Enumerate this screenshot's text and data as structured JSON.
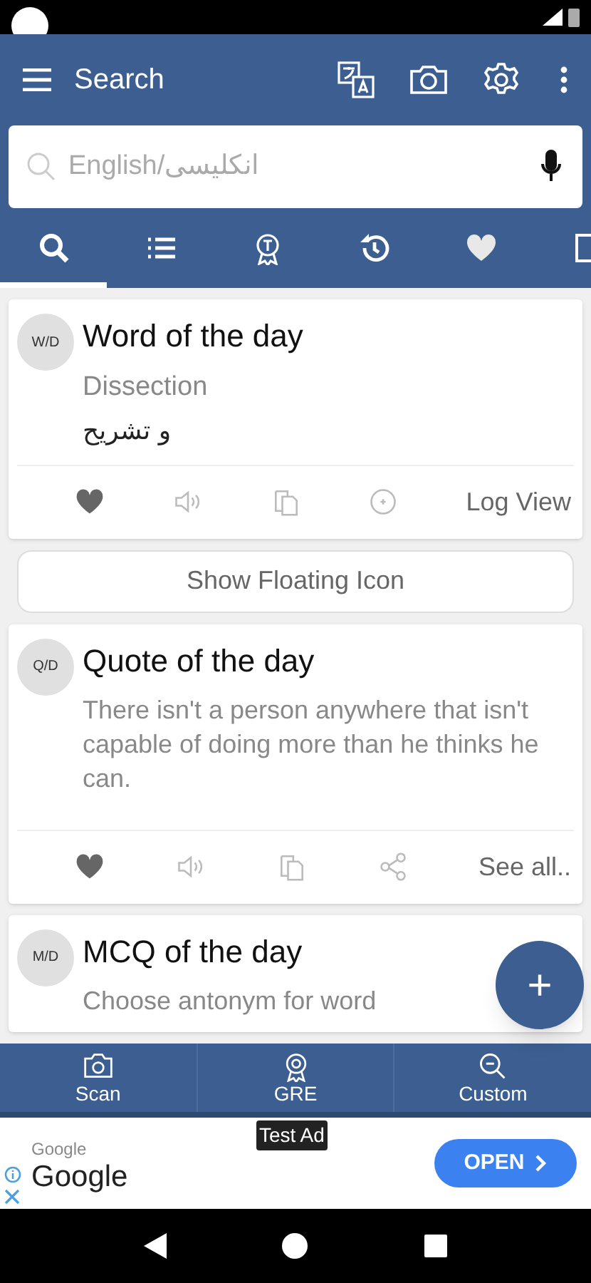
{
  "app_bar": {
    "title": "Search"
  },
  "search": {
    "placeholder": "English/انکلیسی"
  },
  "tabs": [
    {
      "kind": "search",
      "selected": true
    },
    {
      "kind": "list",
      "selected": false
    },
    {
      "kind": "award",
      "selected": false
    },
    {
      "kind": "history",
      "selected": false
    },
    {
      "kind": "heart",
      "selected": false
    },
    {
      "kind": "more",
      "selected": false
    }
  ],
  "cards": [
    {
      "badge": "W/D",
      "title": "Word of the day",
      "lines": [
        {
          "kind": "word",
          "text": "Dissection"
        },
        {
          "kind": "arabic",
          "text": "و تشریح"
        }
      ],
      "actions": [
        {
          "kind": "heart"
        },
        {
          "kind": "speaker"
        },
        {
          "kind": "copy"
        },
        {
          "kind": "add"
        }
      ],
      "link": "Log View"
    },
    {
      "badge": "Q/D",
      "title": "Quote of the day",
      "lines": [
        {
          "kind": "quote",
          "text": "There isn't a person anywhere that isn't capable of doing more than he thinks he can."
        }
      ],
      "actions": [
        {
          "kind": "heart"
        },
        {
          "kind": "speaker"
        },
        {
          "kind": "copy"
        },
        {
          "kind": "share"
        }
      ],
      "link": "See all.."
    },
    {
      "badge": "M/D",
      "title": "MCQ of the day",
      "lines": [
        {
          "kind": "quote",
          "text": "Choose antonym for word"
        }
      ]
    }
  ],
  "floating_button": {
    "label": "Show Floating Icon"
  },
  "fab": {
    "label": "+"
  },
  "bottom_nav": [
    {
      "kind": "camera",
      "label": "Scan"
    },
    {
      "kind": "award",
      "label": "GRE"
    },
    {
      "kind": "zoom",
      "label": "Custom"
    }
  ],
  "ad": {
    "tag": "Test Ad",
    "advertiser": "Google",
    "title": "Google",
    "button": "OPEN"
  }
}
